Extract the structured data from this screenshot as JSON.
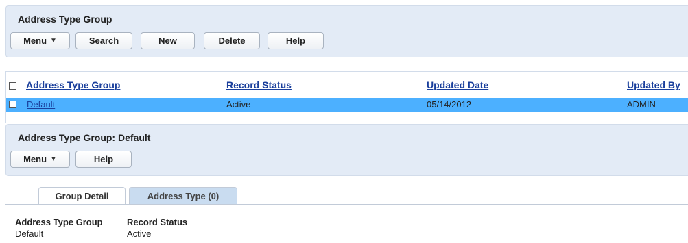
{
  "list_panel": {
    "title": "Address Type Group",
    "buttons": {
      "menu": "Menu",
      "search": "Search",
      "new": "New",
      "delete": "Delete",
      "help": "Help"
    }
  },
  "table": {
    "columns": [
      "Address Type Group",
      "Record Status",
      "Updated Date",
      "Updated By"
    ],
    "rows": [
      {
        "name": "Default",
        "status": "Active",
        "updated_date": "05/14/2012",
        "updated_by": "ADMIN"
      }
    ]
  },
  "detail_panel": {
    "title": "Address Type Group: Default",
    "buttons": {
      "menu": "Menu",
      "help": "Help"
    }
  },
  "tabs": [
    {
      "label": "Group Detail",
      "active": true
    },
    {
      "label": "Address Type (0)",
      "active": false
    }
  ],
  "detail": {
    "fields": [
      {
        "label": "Address Type Group",
        "value": "Default"
      },
      {
        "label": "Record Status",
        "value": "Active"
      }
    ]
  },
  "colors": {
    "panel_bg": "#e3ebf6",
    "row_selected": "#4cb0ff",
    "link": "#1a3f9c"
  }
}
